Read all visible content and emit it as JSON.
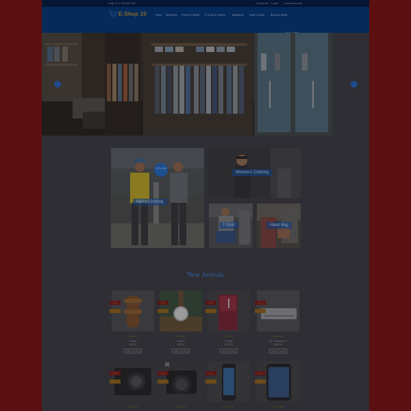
{
  "topbar": {
    "contact": "Help: ✆ 1-234 567 890",
    "links": [
      "Checkout",
      "Login",
      "Create Account"
    ]
  },
  "header": {
    "logo_text": "E-Shop 10",
    "nav": [
      "Home",
      "Electronics",
      "Phones & Tablets",
      "TV, Audio & Camera",
      "Appliances",
      "Home & Living",
      "Beauty & Health"
    ],
    "cart_label": "Cart (0 items)",
    "cart_total": "Total: $0"
  },
  "colors": {
    "page_bg": "#5c0f10",
    "header_bg": "#062a5a",
    "accent_blue": "#2f5fa2",
    "tag_red": "#5c1515",
    "tag_gold": "#6a4a18"
  },
  "categories": [
    {
      "label": "Men's Clothing",
      "badge": "20% Off"
    },
    {
      "label": "Women's Clothing"
    },
    {
      "label": "T-Shirt"
    },
    {
      "label": "Hand Bag"
    }
  ],
  "section_title": "New Arrivals",
  "products": [
    {
      "name": "Sofas",
      "price": "$1218",
      "tag_a": "SALE",
      "tag_b": "HOT",
      "stars": "★★★★★",
      "button": "ADD TO CART",
      "image": "sandal"
    },
    {
      "name": "Watch",
      "price": "$89.00",
      "tag_a": "SALE",
      "tag_b": "HOT",
      "stars": "★★★★★",
      "button": "ADD TO CART",
      "image": "watch"
    },
    {
      "name": "Fridge",
      "price": "$999.00",
      "tag_a": "SALE",
      "tag_b": "HOT",
      "stars": "★★★★★",
      "button": "ADD TO CART",
      "image": "fridge"
    },
    {
      "name": "Air Conditioner",
      "price": "$999.00",
      "tag_a": "SALE",
      "tag_b": "HOT",
      "stars": "★★★★★",
      "button": "ADD TO CART",
      "image": "ac"
    },
    {
      "name": "",
      "price": "",
      "tag_a": "SALE",
      "tag_b": "HOT",
      "stars": "★★★★★",
      "button": "",
      "image": "camera"
    },
    {
      "name": "",
      "price": "",
      "tag_a": "SALE",
      "tag_b": "HOT",
      "stars": "★★★★★",
      "button": "",
      "image": "dslr"
    },
    {
      "name": "",
      "price": "",
      "tag_a": "SALE",
      "tag_b": "HOT",
      "stars": "★★★★★",
      "button": "",
      "image": "phone"
    },
    {
      "name": "",
      "price": "",
      "tag_a": "SALE",
      "tag_b": "HOT",
      "stars": "★★★★★",
      "button": "",
      "image": "tablet"
    }
  ]
}
